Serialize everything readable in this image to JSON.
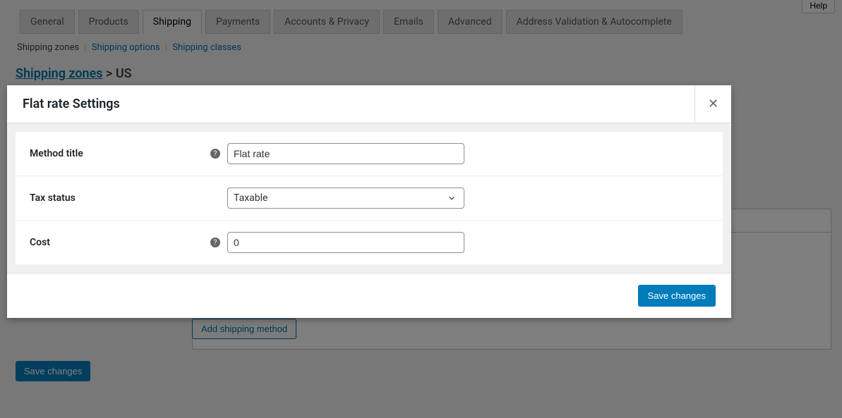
{
  "header": {
    "help": "Help"
  },
  "tabs": {
    "items": [
      {
        "label": "General"
      },
      {
        "label": "Products"
      },
      {
        "label": "Shipping"
      },
      {
        "label": "Payments"
      },
      {
        "label": "Accounts & Privacy"
      },
      {
        "label": "Emails"
      },
      {
        "label": "Advanced"
      },
      {
        "label": "Address Validation & Autocomplete"
      }
    ]
  },
  "subnav": {
    "zones": "Shipping zones",
    "options": "Shipping options",
    "classes": "Shipping classes"
  },
  "breadcrumb": {
    "root": "Shipping zones",
    "sep": ">",
    "current": "US"
  },
  "background": {
    "add_method": "Add shipping method",
    "save": "Save changes"
  },
  "modal": {
    "title": "Flat rate Settings",
    "close": "✕",
    "fields": {
      "method_title": {
        "label": "Method title",
        "value": "Flat rate",
        "help": "?"
      },
      "tax_status": {
        "label": "Tax status",
        "value": "Taxable"
      },
      "cost": {
        "label": "Cost",
        "value": "0",
        "help": "?"
      }
    },
    "footer": {
      "save": "Save changes"
    }
  }
}
